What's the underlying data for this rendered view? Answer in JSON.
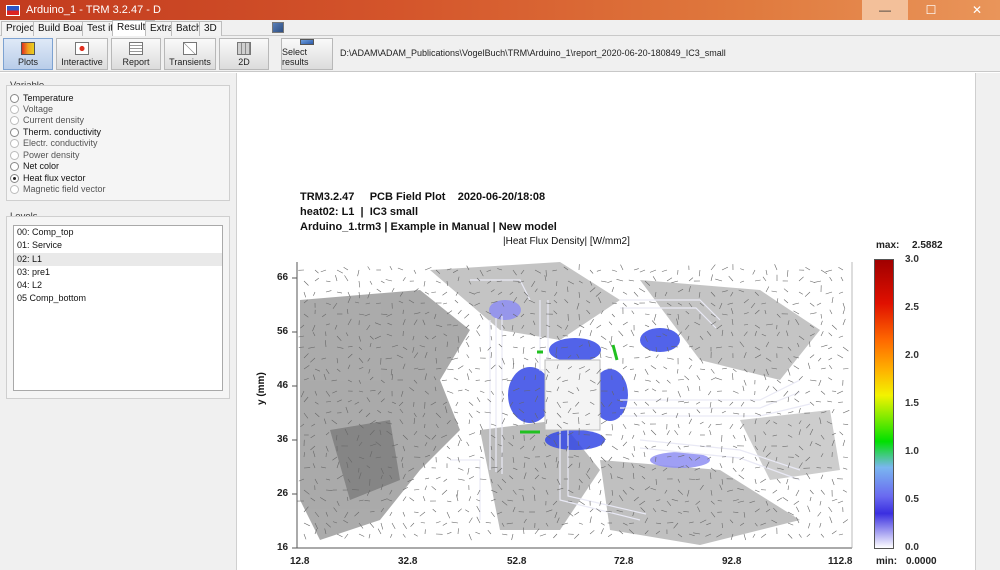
{
  "window": {
    "title": "Arduino_1 - TRM 3.2.47 - D"
  },
  "menu": {
    "tabs": [
      "Project",
      "Build Board",
      "Test it",
      "Results",
      "Extra",
      "Batch",
      "3D"
    ]
  },
  "toolbar": {
    "buttons": [
      "Plots",
      "Interactive",
      "Report",
      "Transients",
      "2D",
      "Select results"
    ],
    "path": "D:\\ADAM\\ADAM_Publications\\VogelBuch\\TRM\\Arduino_1\\report_2020-06-20-180849_IC3_small"
  },
  "variable": {
    "label": "Variable",
    "options": [
      "Temperature",
      "Voltage",
      "Current density",
      "Therm. conductivity",
      "Electr. conductivity",
      "Power density",
      "Net color",
      "Heat flux vector",
      "Magnetic field vector"
    ],
    "selected": "Heat flux vector"
  },
  "levels": {
    "label": "Levels",
    "items": [
      "00: Comp_top",
      "01: Service",
      "02: L1",
      "03: pre1",
      "04: L2",
      "05 Comp_bottom"
    ],
    "selected": "02: L1"
  },
  "plot": {
    "header_line1": "TRM3.2.47     PCB Field Plot    2020-06-20/18:08",
    "header_line2": "heat02: L1  |  IC3 small",
    "header_line3": "Arduino_1.trm3 | Example in Manual | New model",
    "subtitle": "|Heat Flux Density| [W/mm2]",
    "ylabel": "y (mm)",
    "x_ticks": [
      "12.8",
      "32.8",
      "52.8",
      "72.8",
      "92.8",
      "112.8"
    ],
    "y_ticks": [
      "66",
      "56",
      "46",
      "36",
      "26",
      "16"
    ],
    "colorbar": {
      "max_label": "max:",
      "max_value": "2.5882",
      "min_label": "min:",
      "min_value": "0.0000",
      "ticks": [
        "3.0",
        "2.5",
        "2.0",
        "1.5",
        "1.0",
        "0.5",
        "0.0"
      ]
    }
  }
}
